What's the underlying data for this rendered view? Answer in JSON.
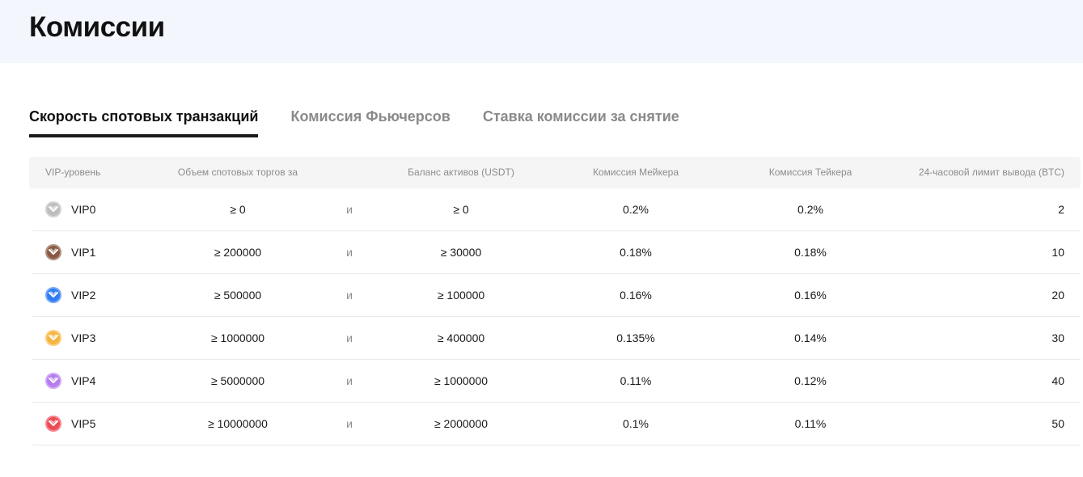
{
  "page": {
    "title": "Комиссии"
  },
  "tabs": [
    {
      "label": "Скорость спотовых транзакций",
      "active": true
    },
    {
      "label": "Комиссия Фьючерсов",
      "active": false
    },
    {
      "label": "Ставка комиссии за снятие",
      "active": false
    }
  ],
  "table": {
    "headers": {
      "level": "VIP-уровень",
      "volume": "Объем спотовых торгов за",
      "balance": "Баланс активов (USDT)",
      "maker": "Комиссия Мейкера",
      "taker": "Комиссия Тейкера",
      "limit": "24-часовой лимит вывода (BTC)"
    },
    "and_label": "и",
    "rows": [
      {
        "level": "VIP0",
        "volume": "≥ 0",
        "balance": "≥ 0",
        "maker": "0.2%",
        "taker": "0.2%",
        "limit": "2",
        "badge_color": "#bdbdbd"
      },
      {
        "level": "VIP1",
        "volume": "≥ 200000",
        "balance": "≥ 30000",
        "maker": "0.18%",
        "taker": "0.18%",
        "limit": "10",
        "badge_color": "#8a5a44"
      },
      {
        "level": "VIP2",
        "volume": "≥ 500000",
        "balance": "≥ 100000",
        "maker": "0.16%",
        "taker": "0.16%",
        "limit": "20",
        "badge_color": "#2f7cf6"
      },
      {
        "level": "VIP3",
        "volume": "≥ 1000000",
        "balance": "≥ 400000",
        "maker": "0.135%",
        "taker": "0.14%",
        "limit": "30",
        "badge_color": "#f7b540"
      },
      {
        "level": "VIP4",
        "volume": "≥ 5000000",
        "balance": "≥ 1000000",
        "maker": "0.11%",
        "taker": "0.12%",
        "limit": "40",
        "badge_color": "#b77cf0"
      },
      {
        "level": "VIP5",
        "volume": "≥ 10000000",
        "balance": "≥ 2000000",
        "maker": "0.1%",
        "taker": "0.11%",
        "limit": "50",
        "badge_color": "#ee4b55"
      }
    ]
  }
}
